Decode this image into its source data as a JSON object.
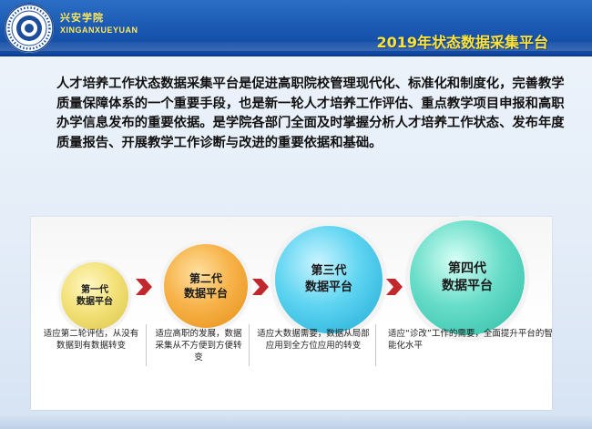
{
  "header": {
    "school_name_cn": "兴安学院",
    "school_name_en": "XINGANXUEYUAN",
    "title": "2019年状态数据采集平台",
    "colors": {
      "bar": "#1957b0",
      "title": "#ffe33a"
    }
  },
  "intro": {
    "text": "人才培养工作状态数据采集平台是促进高职院校管理现代化、标准化和制度化，完善教学质量保障体系的一个重要手段，也是新一轮人才培养工作评估、重点教学项目申报和高职办学信息发布的重要依据。是学院各部门全面及时掌握分析人才培养工作状态、发布年度质量报告、开展教学工作诊断与改进的重要依据和基础。"
  },
  "generations": [
    {
      "line1": "第一代",
      "line2": "数据平台",
      "color": "#f3e27a",
      "description": "适应第二轮评估，从没有数据到有数据转变"
    },
    {
      "line1": "第二代",
      "line2": "数据平台",
      "color": "#f7b34a",
      "description": "适应高职的发展，数据采集从不方便到方便转变"
    },
    {
      "line1": "第三代",
      "line2": "数据平台",
      "color": "#5ed4f1",
      "description": "适应大数据需要，数据从局部应用到全方位应用的转变"
    },
    {
      "line1": "第四代",
      "line2": "数据平台",
      "color": "#68ddc8",
      "description": "适应“诊改”工作的需要，全面提升平台的智能化水平"
    }
  ],
  "arrow_color": "#c0282d"
}
